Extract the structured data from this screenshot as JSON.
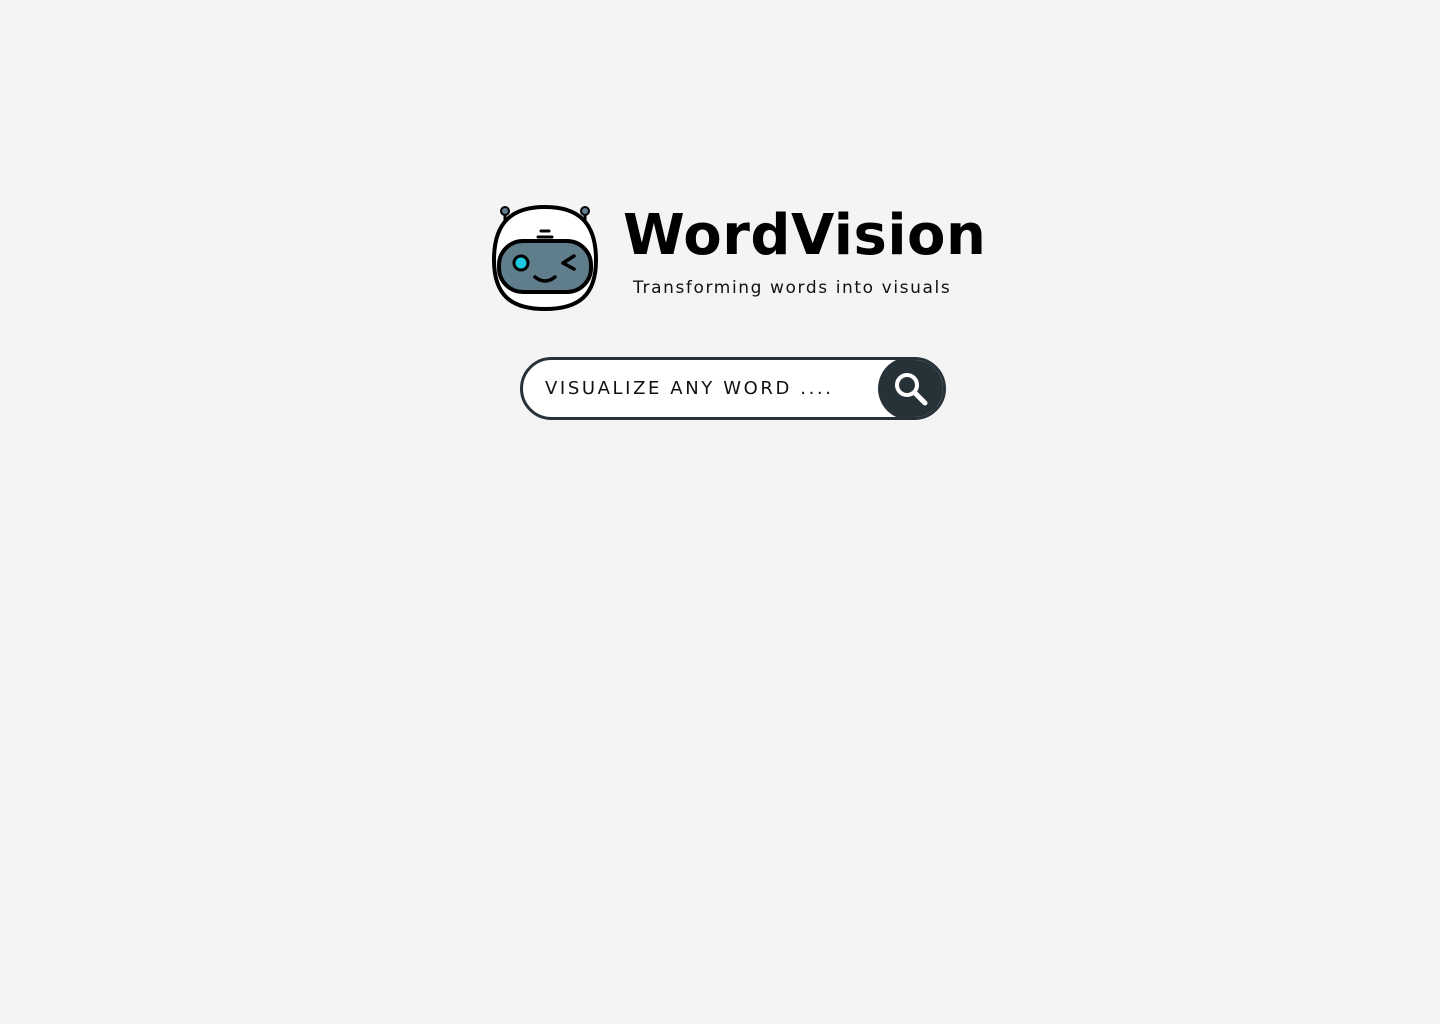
{
  "header": {
    "title": "WordVision",
    "tagline": "Transforming words into visuals",
    "logo_icon": "robot-winking-icon"
  },
  "search": {
    "placeholder": "VISUALIZE ANY WORD ....",
    "value": "",
    "button_icon": "search-icon"
  },
  "colors": {
    "background": "#f4f4f4",
    "accent": "#263238",
    "visor": "#5f7d8b",
    "eye": "#1ec8e0"
  }
}
